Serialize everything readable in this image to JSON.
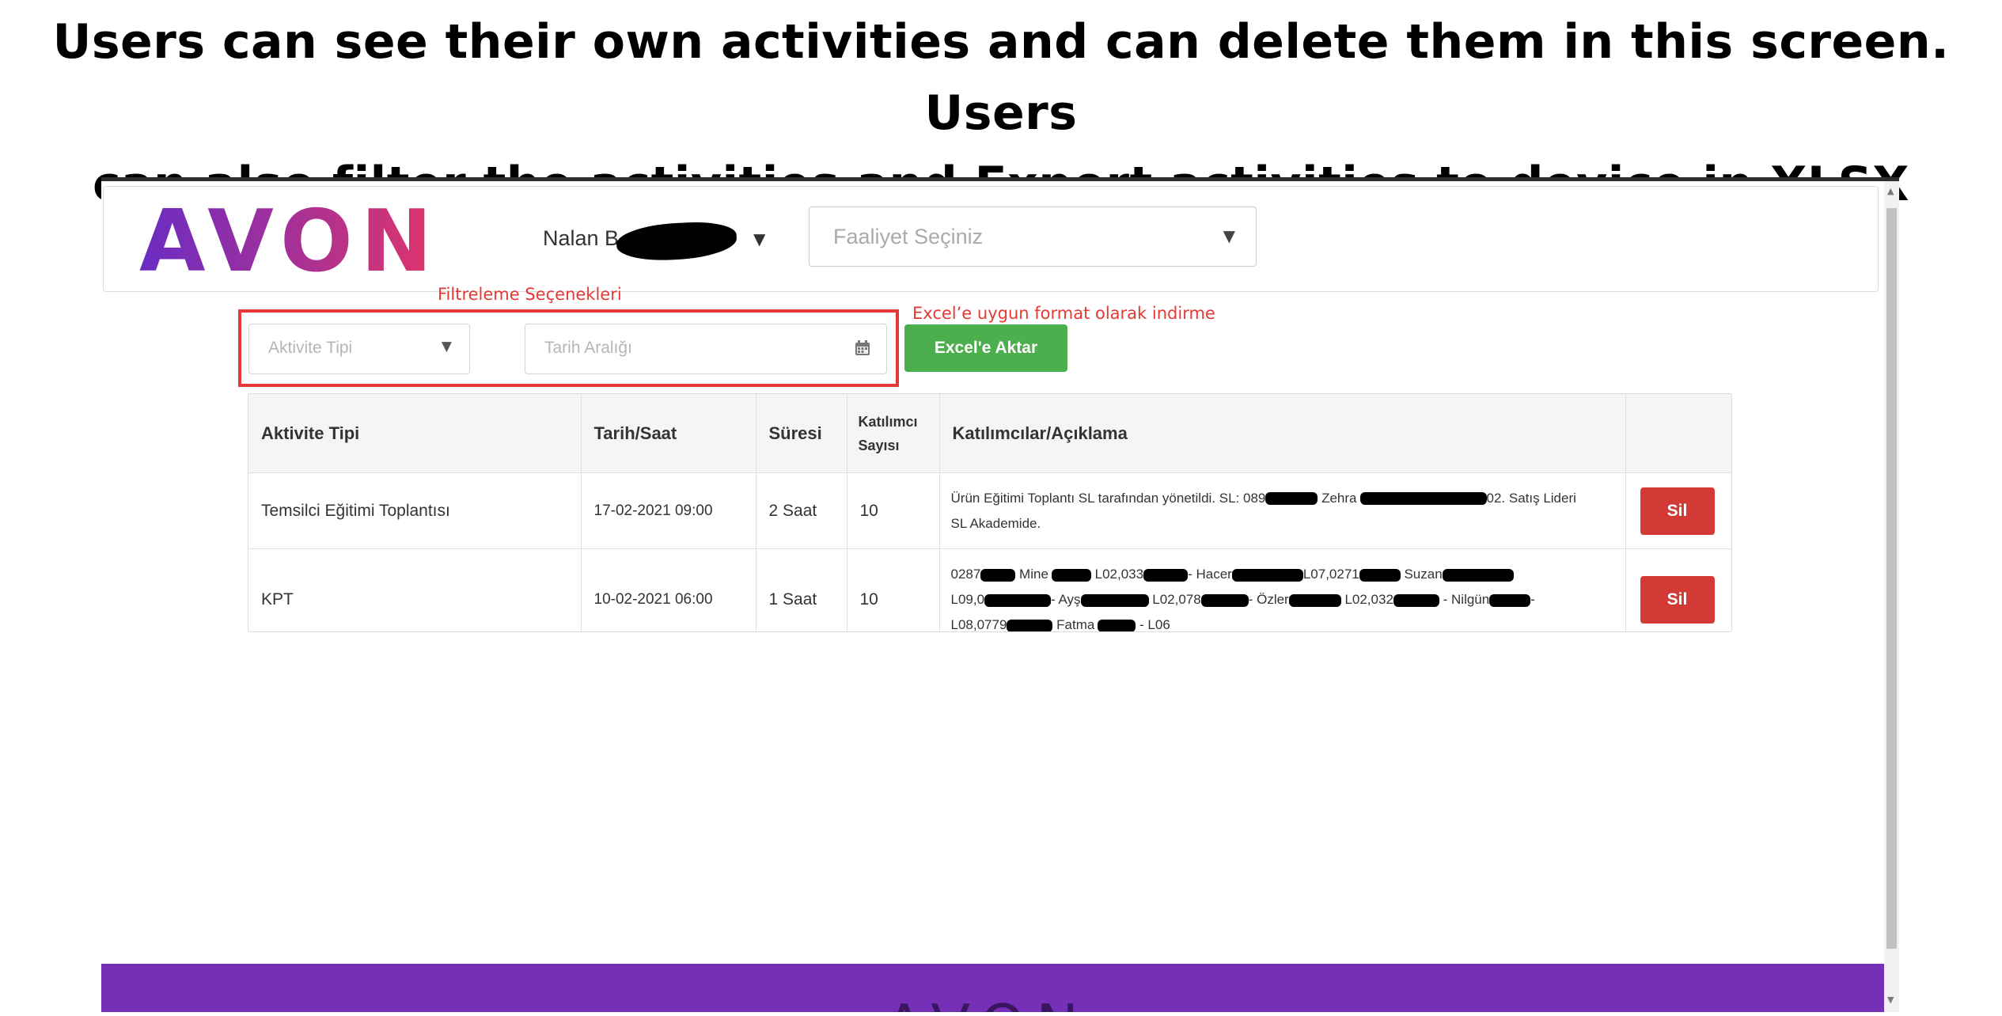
{
  "caption": {
    "line1": "Users can see their own activities and can delete them in this screen. Users",
    "line2": "can also filter the activities and Export activities to device in XLSX format"
  },
  "header": {
    "logo_text": "AVON",
    "user_name": "Nalan B",
    "activity_select_placeholder": "Faaliyet Seçiniz"
  },
  "annotations": {
    "filter_options": "Filtreleme Seçenekleri",
    "excel_note": "Excel’e uygun format olarak indirme"
  },
  "filters": {
    "activity_type_placeholder": "Aktivite Tipi",
    "date_range_placeholder": "Tarih Aralığı",
    "export_button": "Excel'e Aktar"
  },
  "table": {
    "headers": [
      "Aktivite Tipi",
      "Tarih/Saat",
      "Süresi",
      "Katılımcı Sayısı",
      "Katılımcılar/Açıklama",
      ""
    ],
    "header_participants_line1": "Katılımcı",
    "header_participants_line2": "Sayısı",
    "rows": [
      {
        "type": "Temsilci Eğitimi Toplantısı",
        "datetime": "17-02-2021 09:00",
        "duration": "2 Saat",
        "count": "10",
        "desc_a": "Ürün Eğitimi Toplantı SL tarafından yönetildi. SL: 089",
        "desc_b": " Zehra",
        "desc_c": "02. Satış Lideri",
        "desc_d": "SL Akademide.",
        "delete": "Sil"
      },
      {
        "type": "KPT",
        "datetime": "10-02-2021 06:00",
        "duration": "1 Saat",
        "count": "10",
        "l1a": "0287",
        "l1b": " Mine",
        "l1c": " L02,033",
        "l1d": "- Hacer",
        "l1e": "L07,0271",
        "l1f": " Suzan",
        "l2a": "L09,0",
        "l2b": "- Ayş",
        "l2c": " L02,078",
        "l2d": "- Özler",
        "l2e": " L02,032",
        "l2f": " - Nilgün",
        "l2g": "-",
        "l3a": "L08,0779",
        "l3b": " Fatma",
        "l3c": " - L06",
        "delete": "Sil"
      }
    ]
  },
  "footer": {
    "logo_text": "AVON"
  },
  "colors": {
    "avon_gradient_start": "#6a2cc4",
    "avon_gradient_end": "#e0356a",
    "annotation_red": "#e53935",
    "excel_green": "#4cae4c",
    "delete_red": "#d33a36",
    "footer_purple": "#7630b8"
  }
}
